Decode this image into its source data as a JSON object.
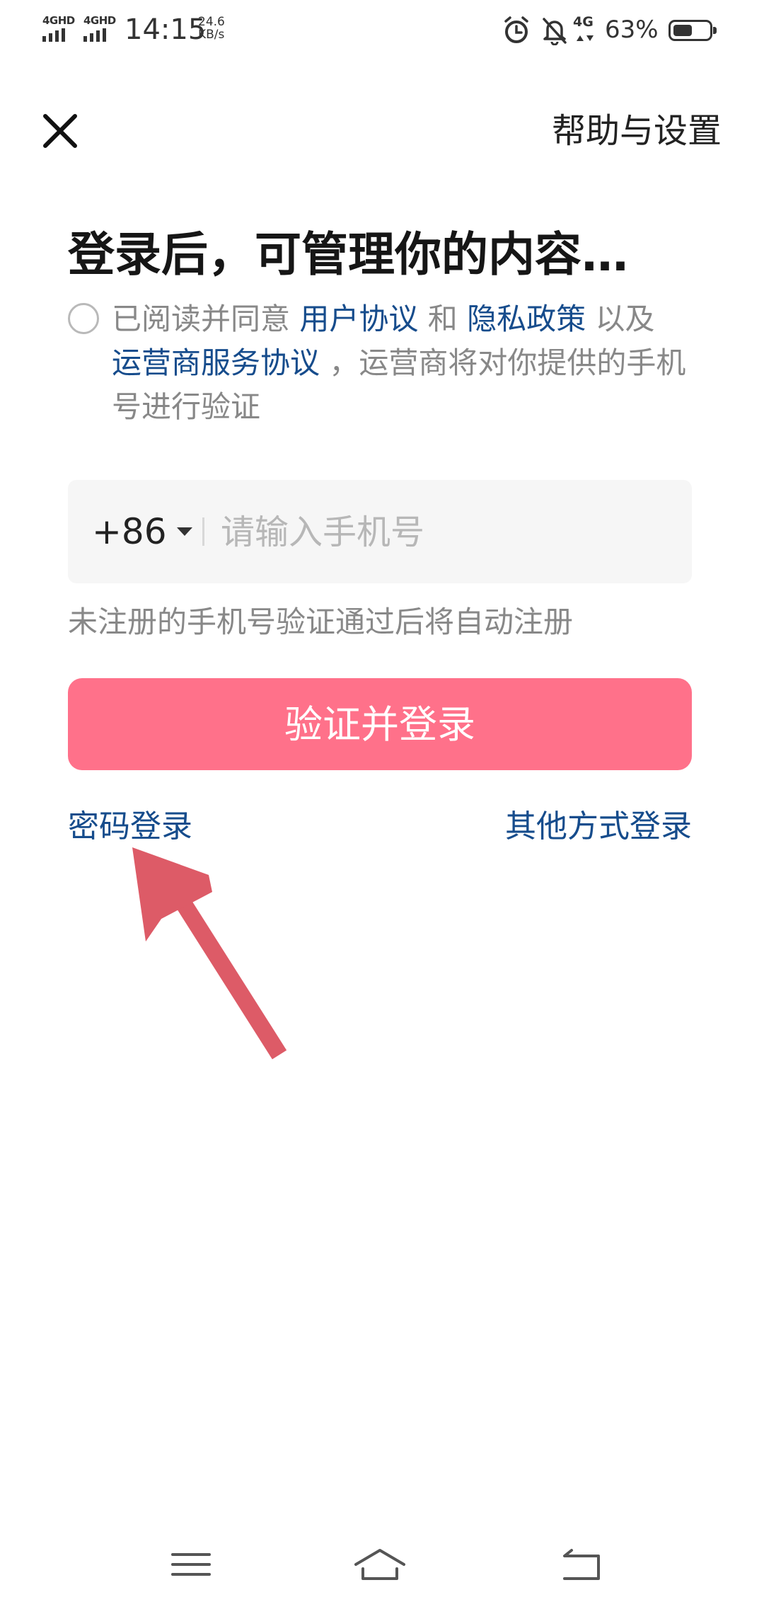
{
  "status_bar": {
    "sim1": "4GHD",
    "sim2": "4GHD",
    "time": "14:15",
    "speed_value": "24.6",
    "speed_unit": "KB/s",
    "net_badge": "4G",
    "battery_percent": "63%",
    "battery_level": 0.63,
    "icons": [
      "alarm-icon",
      "bell-off-icon",
      "4g-data-icon",
      "battery-icon"
    ]
  },
  "header": {
    "close_icon": "close-icon",
    "help_label": "帮助与设置"
  },
  "title": "登录后，可管理你的内容…",
  "agreement": {
    "prefix": "已阅读并同意 ",
    "user_agreement": "用户协议",
    "and": " 和 ",
    "privacy_policy": "隐私政策",
    "as_well_as": " 以及",
    "carrier_agreement": "运营商服务协议",
    "suffix": " ，运营商将对你提供的手机号进行验证"
  },
  "phone": {
    "country_code": "+86",
    "placeholder": "请输入手机号",
    "value": ""
  },
  "hint": "未注册的手机号验证通过后将自动注册",
  "login_button": "验证并登录",
  "password_login": "密码登录",
  "other_login": "其他方式登录",
  "nav_bar": {
    "items": [
      "menu-icon",
      "home-icon",
      "back-icon"
    ]
  },
  "colors": {
    "accent": "#ff718a",
    "link": "#164c8c",
    "annotation": "#dd5b67"
  }
}
